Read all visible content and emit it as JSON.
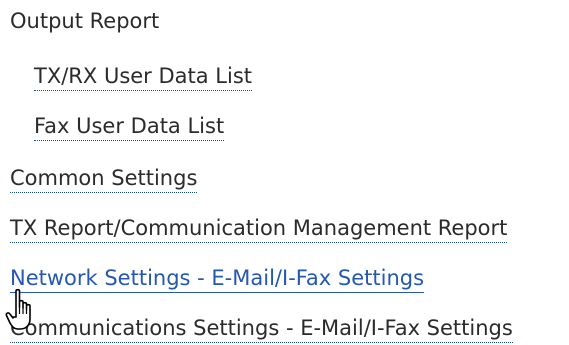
{
  "menu": {
    "heading": "Output Report",
    "items": [
      {
        "label": "TX/RX User Data List",
        "level": 2
      },
      {
        "label": "Fax User Data List",
        "level": 2
      },
      {
        "label": "Common Settings",
        "level": 1
      },
      {
        "label": "TX Report/Communication Management Report",
        "level": 1
      },
      {
        "label": "Network Settings - E-Mail/I-Fax Settings",
        "level": 1,
        "state": "hovered"
      },
      {
        "label": "Communications Settings - E-Mail/I-Fax Settings",
        "level": 1
      }
    ]
  },
  "cursor": {
    "icon": "hand-pointer-icon"
  },
  "colors": {
    "text": "#2b2b2b",
    "link_hover": "#2458b3",
    "link_underline": "#1f4e8c"
  }
}
